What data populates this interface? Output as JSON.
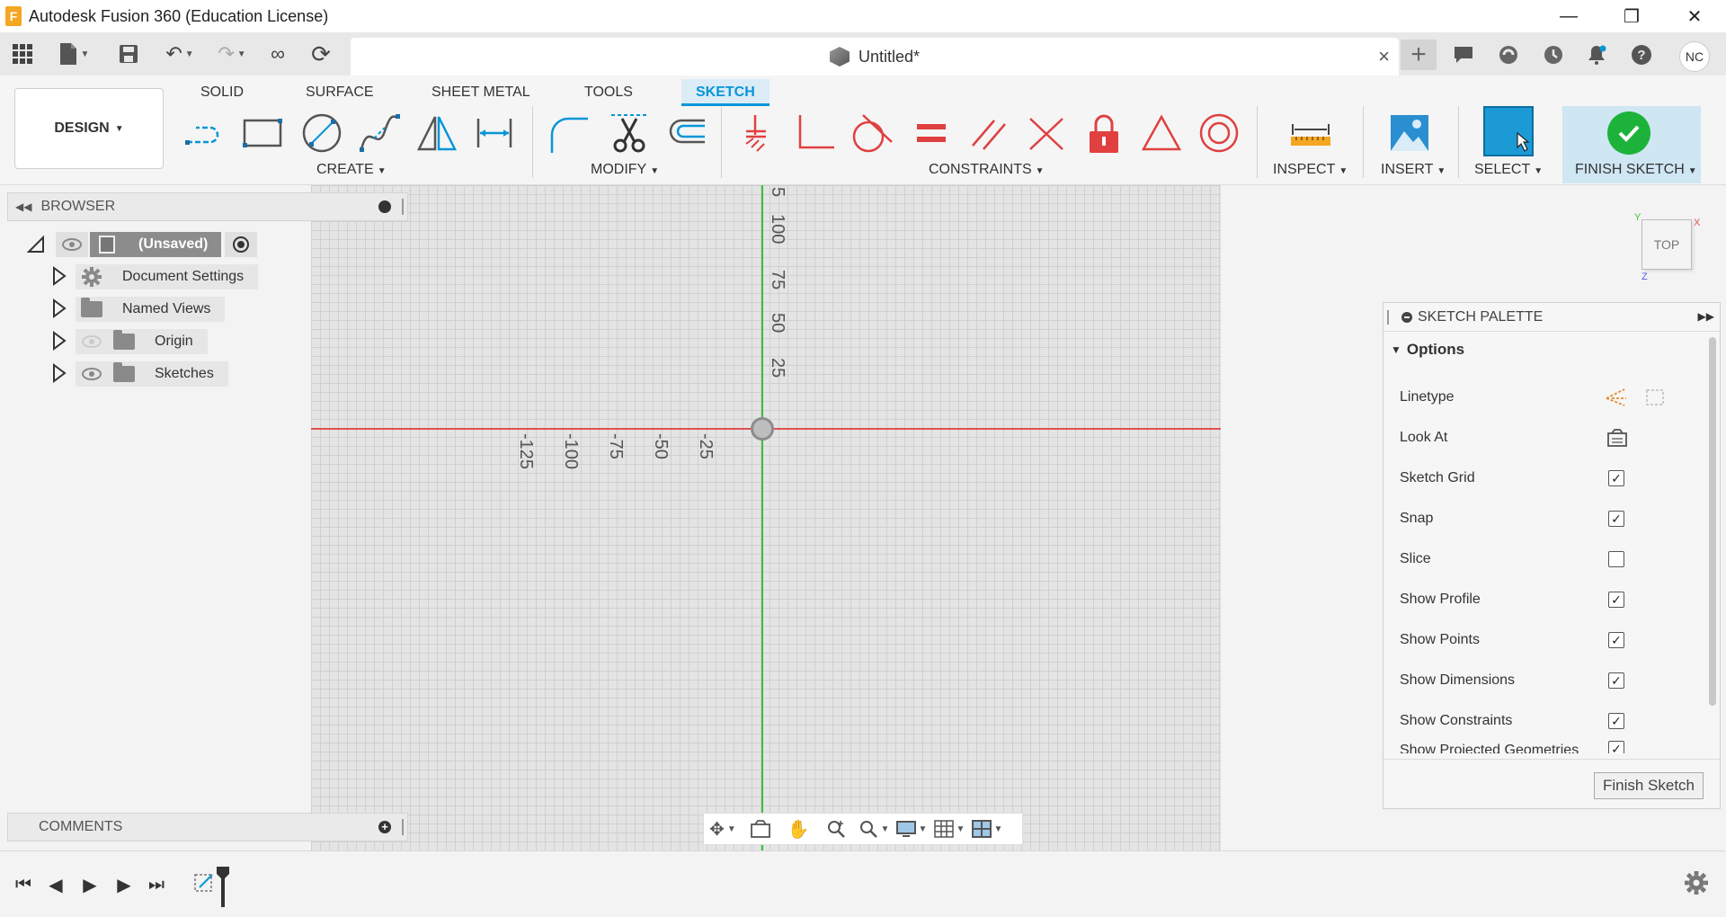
{
  "window": {
    "title": "Autodesk Fusion 360 (Education License)",
    "app_icon_letter": "F",
    "controls": {
      "minimize": "—",
      "restore": "❐",
      "close": "✕"
    }
  },
  "document_tab": {
    "name": "Untitled*",
    "close": "×"
  },
  "user": {
    "initials": "NC"
  },
  "ribbon": {
    "workspace": "DESIGN",
    "tabs": [
      {
        "label": "SOLID",
        "active": false
      },
      {
        "label": "SURFACE",
        "active": false
      },
      {
        "label": "SHEET METAL",
        "active": false
      },
      {
        "label": "TOOLS",
        "active": false
      },
      {
        "label": "SKETCH",
        "active": true
      }
    ],
    "groups": {
      "create": "CREATE",
      "modify": "MODIFY",
      "constraints": "CONSTRAINTS",
      "inspect": "INSPECT",
      "insert": "INSERT",
      "select": "SELECT",
      "finish": "FINISH SKETCH"
    }
  },
  "browser": {
    "title": "BROWSER",
    "root": "(Unsaved)",
    "items": [
      {
        "label": "Document Settings",
        "icon": "gear-icon"
      },
      {
        "label": "Named Views",
        "icon": "folder-icon"
      },
      {
        "label": "Origin",
        "icon": "folder-icon",
        "visible": false
      },
      {
        "label": "Sketches",
        "icon": "folder-icon",
        "visible": true
      }
    ]
  },
  "canvas": {
    "y_ticks": [
      "5",
      "100",
      "75",
      "50",
      "25"
    ],
    "x_ticks": [
      "-125",
      "-100",
      "-75",
      "-50",
      "-25"
    ]
  },
  "viewcube": {
    "label": "TOP",
    "x": "X",
    "y": "Y",
    "z": "Z"
  },
  "sketch_palette": {
    "title": "SKETCH PALETTE",
    "section": "Options",
    "rows": [
      {
        "label": "Linetype",
        "kind": "icons"
      },
      {
        "label": "Look At",
        "kind": "icon"
      },
      {
        "label": "Sketch Grid",
        "checked": true
      },
      {
        "label": "Snap",
        "checked": true
      },
      {
        "label": "Slice",
        "checked": false
      },
      {
        "label": "Show Profile",
        "checked": true
      },
      {
        "label": "Show Points",
        "checked": true
      },
      {
        "label": "Show Dimensions",
        "checked": true
      },
      {
        "label": "Show Constraints",
        "checked": true
      },
      {
        "label": "Show Projected Geometries",
        "checked": true
      }
    ],
    "finish_button": "Finish Sketch"
  },
  "comments": {
    "title": "COMMENTS"
  },
  "colors": {
    "accent": "#0696d7",
    "x_axis": "#e05050",
    "y_axis": "#3cbf3c",
    "finish_green": "#1db33a",
    "constraint_red": "#e04040"
  }
}
